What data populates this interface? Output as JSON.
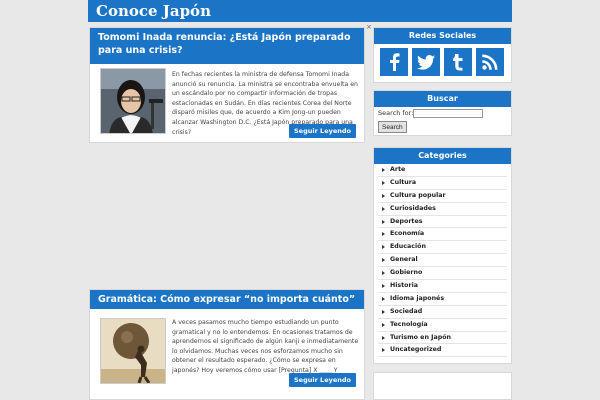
{
  "header": {
    "site_title": "Conoce Japón"
  },
  "posts": [
    {
      "title": "Tomomi Inada renuncia: ¿Está Japón preparado para una crisis?",
      "excerpt": "En fechas recientes la ministra de defensa Tomomi Inada anunció su renuncia. La ministra se encontraba envuelta en un escándalo por no compartir información de tropas estacionadas en Sudán. En días recientes Corea del Norte disparó misiles que, de acuerdo a Kim Jong-un pueden alcanzar Washington D.C. ¿Está Japón preparado para una crisis?",
      "read_more": "Seguir Leyendo"
    },
    {
      "title": "Gramática: Cómo expresar “no importa cuánto” con ＿＿",
      "excerpt": "A veces pasamos mucho tiempo estudiando un punto gramatical y no lo entendemos. En ocasiones tratamos de aprendernos el significado de algún kanji e inmediatamente lo olvidamos. Muchas veces nos esforzamos mucho sin obtener el resultado esperado. ¿Cómo se expresa en japonés? Hoy veremos cómo usar [Pregunta] X ＿＿ Y",
      "read_more": "Seguir Leyendo"
    }
  ],
  "close_mark": "×",
  "sidebar": {
    "social": {
      "title": "Redes Sociales",
      "icons": [
        {
          "name": "facebook-icon",
          "glyph": "f"
        },
        {
          "name": "twitter-icon",
          "glyph": "🐦"
        },
        {
          "name": "tumblr-icon",
          "glyph": "t"
        },
        {
          "name": "rss-icon",
          "glyph": "◔"
        }
      ]
    },
    "search": {
      "title": "Buscar",
      "label": "Search for:",
      "value": "",
      "button": "Search"
    },
    "categories": {
      "title": "Categories",
      "items": [
        "Arte",
        "Cultura",
        "Cultura popular",
        "Curiosidades",
        "Deportes",
        "Economía",
        "Educación",
        "General",
        "Gobierno",
        "Historia",
        "Idioma japonés",
        "Sociedad",
        "Tecnología",
        "Turismo en Japón",
        "Uncategorized"
      ]
    }
  },
  "colors": {
    "accent": "#1b74c6",
    "background": "#e8e8e8"
  }
}
